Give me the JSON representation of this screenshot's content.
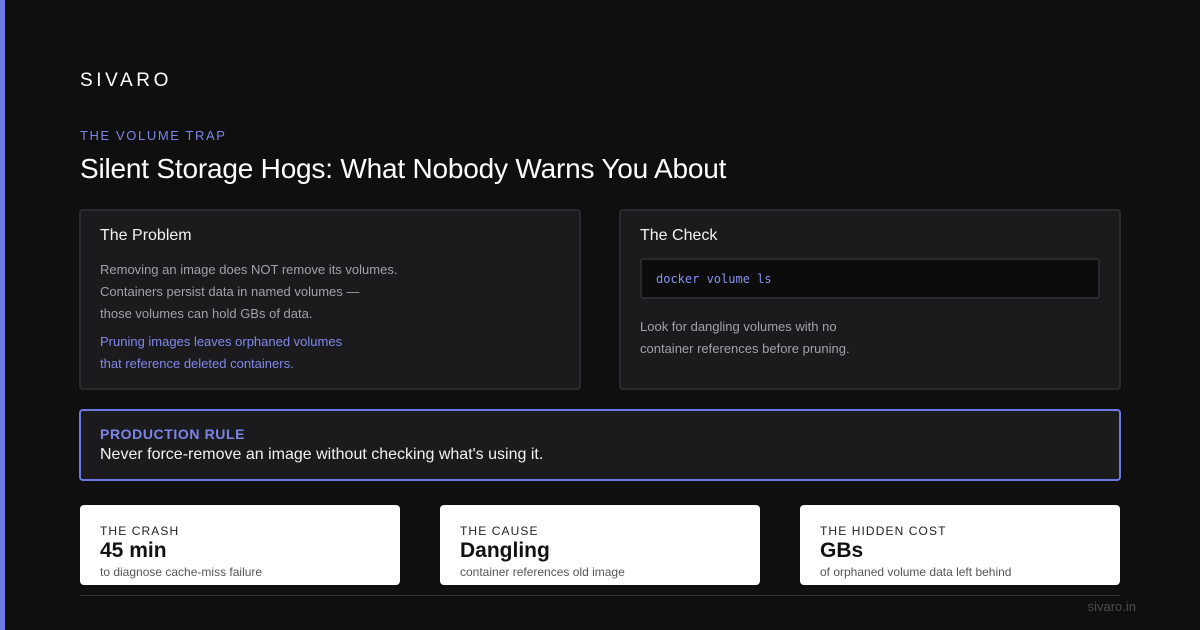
{
  "colors": {
    "background": "#0f0f10",
    "accent": "#6f79e6",
    "accent_text": "#7d84e8",
    "card_bg": "#1b1b1e",
    "stat_bg": "#ffffff"
  },
  "brand": "SIVARO",
  "eyebrow": "THE VOLUME TRAP",
  "title": "Silent Storage Hogs: What Nobody Warns You About",
  "problem": {
    "title": "The Problem",
    "lines": [
      "Removing an image does NOT remove its volumes.",
      "Containers persist data in named volumes —",
      "those volumes can hold GBs of data."
    ],
    "highlight": [
      "Pruning images leaves orphaned volumes",
      "that reference deleted containers."
    ]
  },
  "check": {
    "title": "The Check",
    "command": "docker volume ls",
    "lines": [
      "Look for dangling volumes with no",
      "container references before pruning."
    ]
  },
  "rule": {
    "label": "PRODUCTION RULE",
    "text": "Never force-remove an image without checking what's using it."
  },
  "stats": [
    {
      "label": "THE CRASH",
      "value": "45 min",
      "caption": "to diagnose cache-miss failure"
    },
    {
      "label": "THE CAUSE",
      "value": "Dangling",
      "caption": "container references old image"
    },
    {
      "label": "THE HIDDEN COST",
      "value": "GBs",
      "caption": "of orphaned volume data left behind"
    }
  ],
  "footer": {
    "url": "sivaro.in"
  }
}
